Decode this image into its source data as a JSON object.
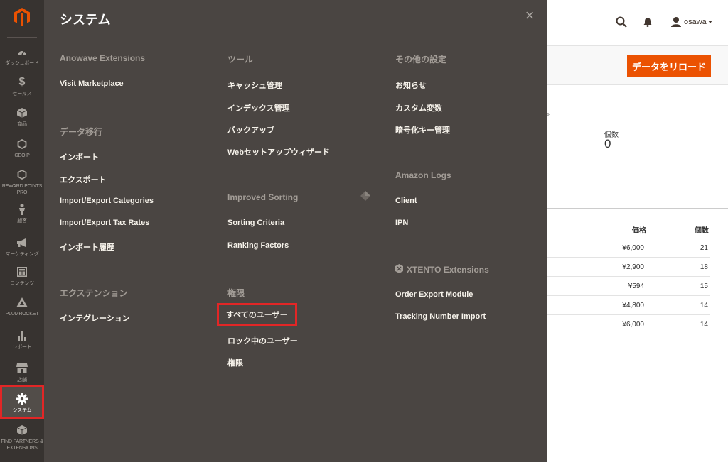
{
  "sidebar": {
    "items": [
      {
        "label": "ダッシュボード",
        "icon": "dashboard-icon"
      },
      {
        "label": "セールス",
        "icon": "dollar-icon"
      },
      {
        "label": "商品",
        "icon": "cube-icon"
      },
      {
        "label": "GEOIP",
        "icon": "hexagon-icon"
      },
      {
        "label": "REWARD POINTS PRO",
        "icon": "hexagon-icon"
      },
      {
        "label": "顧客",
        "icon": "person-icon"
      },
      {
        "label": "マーケティング",
        "icon": "megaphone-icon"
      },
      {
        "label": "コンテンツ",
        "icon": "layout-icon"
      },
      {
        "label": "PLUMROCKET",
        "icon": "plumrocket-icon"
      },
      {
        "label": "レポート",
        "icon": "bar-chart-icon"
      },
      {
        "label": "店舗",
        "icon": "store-icon"
      },
      {
        "label": "システム",
        "icon": "gear-icon"
      },
      {
        "label": "FIND PARTNERS & EXTENSIONS",
        "icon": "box-icon"
      }
    ]
  },
  "flyout": {
    "title": "システム",
    "columns": [
      {
        "sections": [
          {
            "heading": "Anowave Extensions",
            "items": [
              "Visit Marketplace"
            ]
          },
          {
            "heading": "データ移行",
            "items": [
              "インポート",
              "エクスポート",
              "Import/Export Categories",
              "Import/Export Tax Rates",
              "インポート履歴"
            ]
          },
          {
            "heading": "エクステンション",
            "items": [
              "インテグレーション"
            ]
          }
        ]
      },
      {
        "sections": [
          {
            "heading": "ツール",
            "items": [
              "キャッシュ管理",
              "インデックス管理",
              "バックアップ",
              "Webセットアップウィザード"
            ]
          },
          {
            "heading": "Improved Sorting",
            "items": [
              "Sorting Criteria",
              "Ranking Factors"
            ]
          },
          {
            "heading": "権限",
            "items": [
              "すべてのユーザー",
              "ロック中のユーザー",
              "権限"
            ]
          }
        ]
      },
      {
        "sections": [
          {
            "heading": "その他の設定",
            "items": [
              "お知らせ",
              "カスタム変数",
              "暗号化キー管理"
            ]
          },
          {
            "heading": "Amazon Logs",
            "items": [
              "Client",
              "IPN"
            ]
          },
          {
            "heading": "XTENTO Extensions",
            "items": [
              "Order Export Module",
              "Tracking Number Import"
            ]
          }
        ]
      }
    ]
  },
  "header": {
    "username": "osawa"
  },
  "page": {
    "reload_button": "データをリロード",
    "dot": "。",
    "qty_label": "個数",
    "qty_value": "0",
    "table": {
      "headers": [
        "価格",
        "個数"
      ],
      "rows": [
        {
          "price": "¥6,000",
          "count": "21"
        },
        {
          "price": "¥2,900",
          "count": "18"
        },
        {
          "price": "¥594",
          "count": "15"
        },
        {
          "price": "¥4,800",
          "count": "14"
        },
        {
          "price": "¥6,000",
          "count": "14"
        }
      ]
    }
  },
  "colors": {
    "sidebar_bg": "#373330",
    "flyout_bg": "#4a4542",
    "accent": "#eb5202",
    "highlight_border": "#e22626"
  }
}
